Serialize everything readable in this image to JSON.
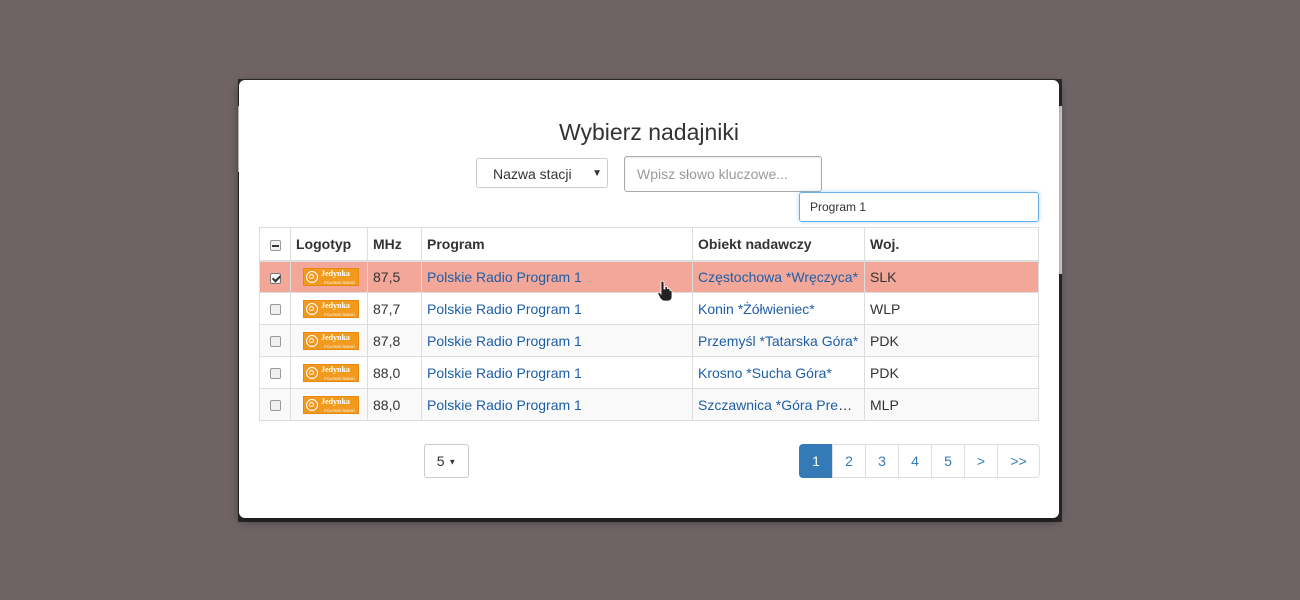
{
  "dialog": {
    "title": "Wybierz nadajniki",
    "search_field_select": "Nazwa stacji",
    "keyword_placeholder": "Wpisz słowo kluczowe...",
    "filter_value": "Program 1"
  },
  "table": {
    "headers": {
      "logo": "Logotyp",
      "mhz": "MHz",
      "program": "Program",
      "object": "Obiekt nadawczy",
      "region": "Woj."
    },
    "rows": [
      {
        "checked": true,
        "logo_brand": "Jedynka",
        "logo_sub": "POLSKIE RADIO",
        "mhz": "87,5",
        "program": "Polskie Radio Program 1",
        "object": "Częstochowa *Wręczyca*",
        "region": "SLK"
      },
      {
        "checked": false,
        "logo_brand": "Jedynka",
        "logo_sub": "POLSKIE RADIO",
        "mhz": "87,7",
        "program": "Polskie Radio Program 1",
        "object": "Konin *Żółwieniec*",
        "region": "WLP"
      },
      {
        "checked": false,
        "logo_brand": "Jedynka",
        "logo_sub": "POLSKIE RADIO",
        "mhz": "87,8",
        "program": "Polskie Radio Program 1",
        "object": "Przemyśl *Tatarska Góra*",
        "region": "PDK"
      },
      {
        "checked": false,
        "logo_brand": "Jedynka",
        "logo_sub": "POLSKIE RADIO",
        "mhz": "88,0",
        "program": "Polskie Radio Program 1",
        "object": "Krosno *Sucha Góra*",
        "region": "PDK"
      },
      {
        "checked": false,
        "logo_brand": "Jedynka",
        "logo_sub": "POLSKIE RADIO",
        "mhz": "88,0",
        "program": "Polskie Radio Program 1",
        "object": "Szczawnica *Góra Prehyba*",
        "region": "MLP"
      }
    ]
  },
  "footer": {
    "page_size": "5",
    "pages": [
      "1",
      "2",
      "3",
      "4",
      "5",
      ">",
      ">>"
    ],
    "active_page": "1"
  },
  "colors": {
    "selected_row": "#f2a798",
    "link": "#1e5ea8",
    "active_page": "#337ab7",
    "overlay": "#6e6466"
  }
}
